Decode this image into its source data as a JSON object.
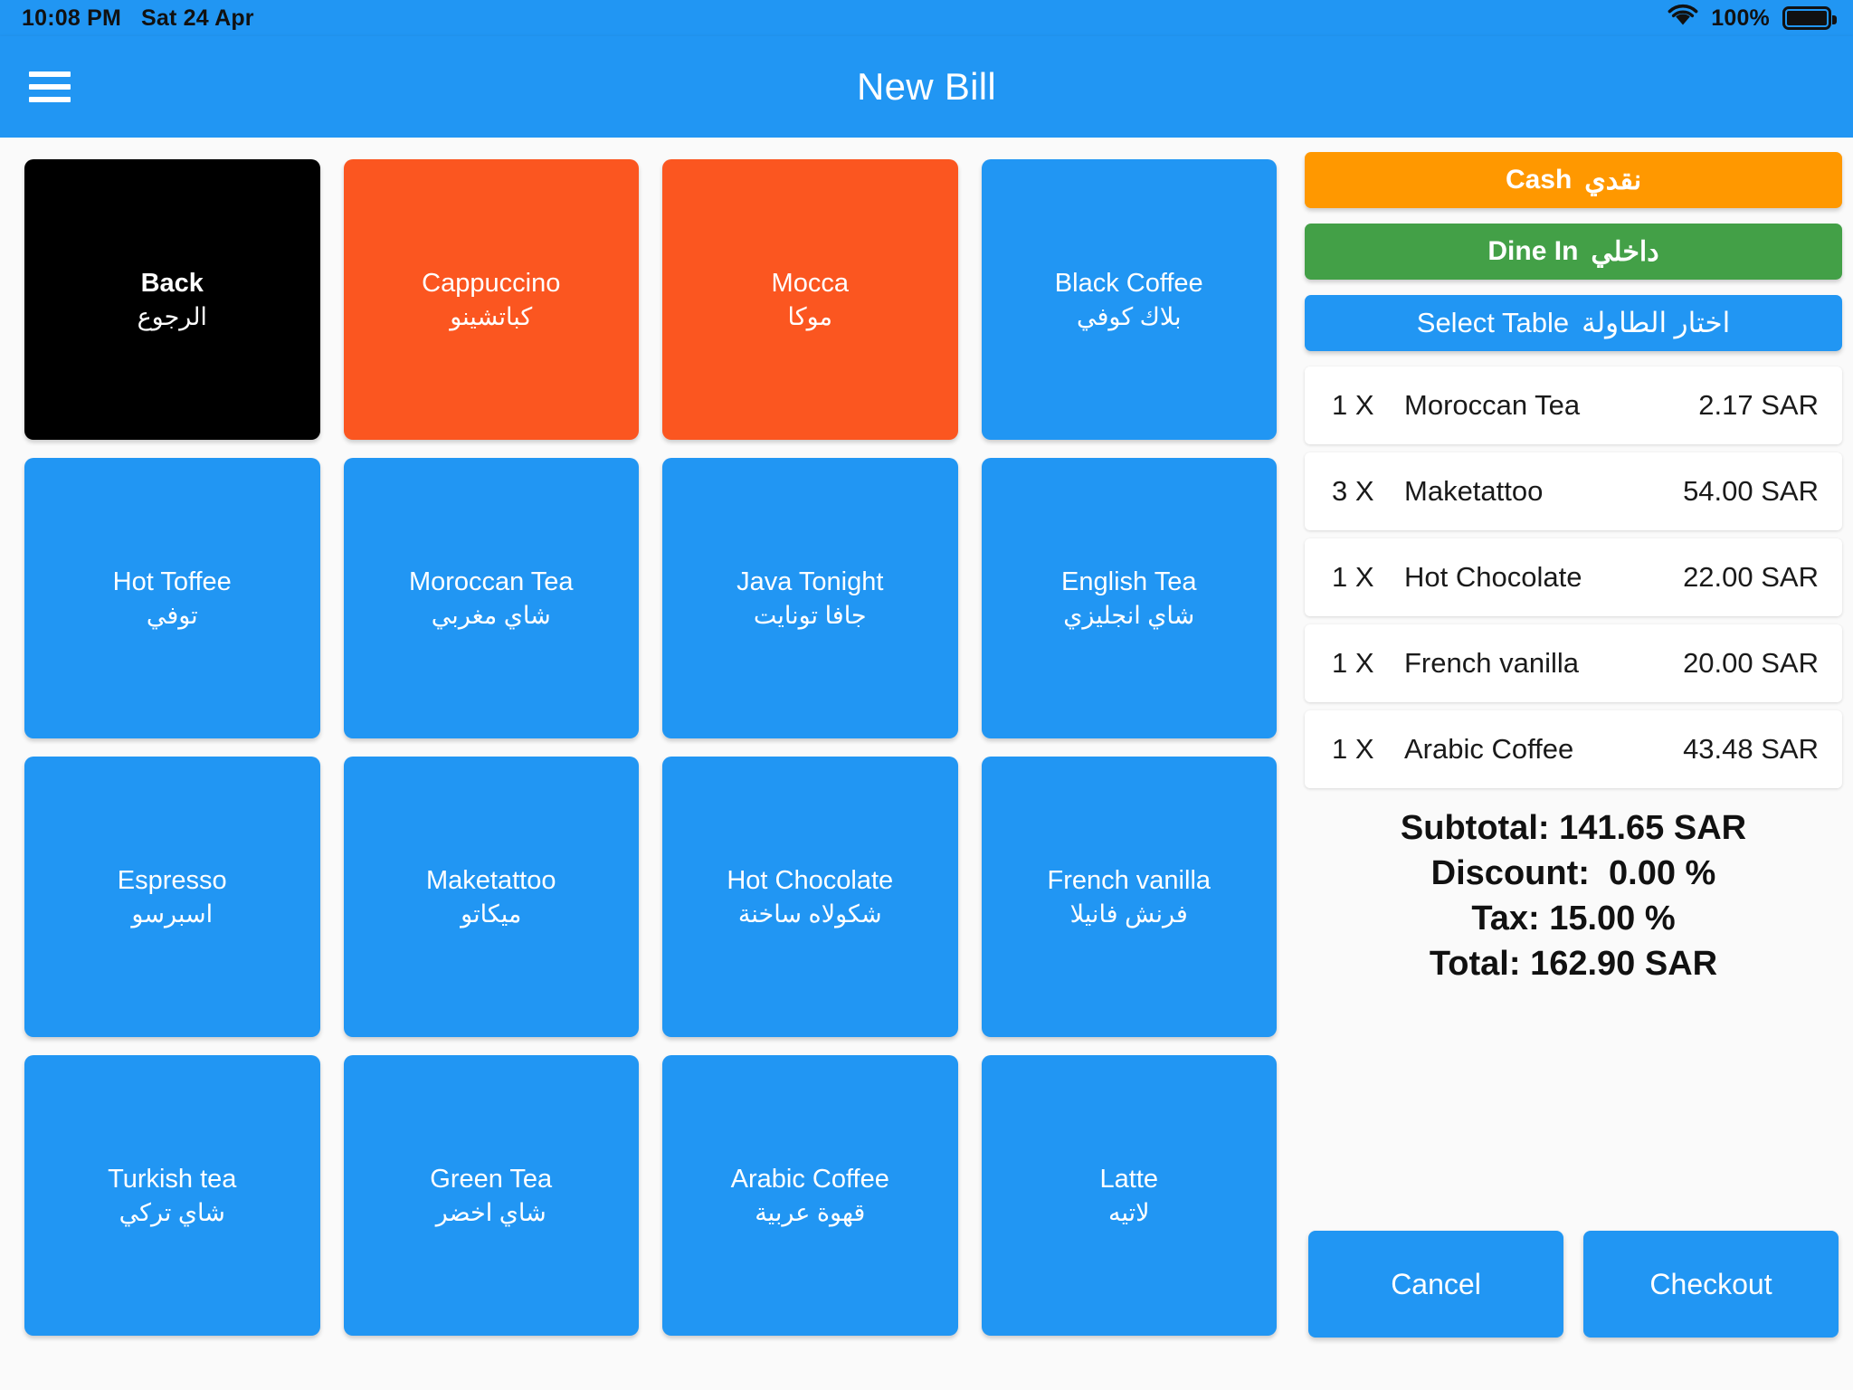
{
  "status_bar": {
    "time": "10:08 PM",
    "date": "Sat 24 Apr",
    "battery_percent": "100%",
    "wifi_icon": "wifi-icon",
    "battery_icon": "battery-full-icon"
  },
  "header": {
    "title": "New Bill",
    "menu_icon": "hamburger-menu-icon"
  },
  "colors": {
    "primary_blue": "#2196F3",
    "tile_orange": "#FB5620",
    "tile_black": "#000000",
    "cash_orange": "#FF9800",
    "dine_green": "#43A047",
    "page_background": "#FAFAFA",
    "card_white": "#FFFFFF"
  },
  "tiles": [
    {
      "en": "Back",
      "ar": "الرجوع",
      "color": "black"
    },
    {
      "en": "Cappuccino",
      "ar": "كباتشينو",
      "color": "orange"
    },
    {
      "en": "Mocca",
      "ar": "موكا",
      "color": "orange"
    },
    {
      "en": "Black Coffee",
      "ar": "بلاك كوفي",
      "color": "blue"
    },
    {
      "en": "Hot Toffee",
      "ar": "توفي",
      "color": "blue"
    },
    {
      "en": "Moroccan Tea",
      "ar": "شاي مغربي",
      "color": "blue"
    },
    {
      "en": "Java Tonight",
      "ar": "جافا تونايت",
      "color": "blue"
    },
    {
      "en": "English Tea",
      "ar": "شاي انجليزي",
      "color": "blue"
    },
    {
      "en": "Espresso",
      "ar": "اسبرسو",
      "color": "blue"
    },
    {
      "en": "Maketattoo",
      "ar": "ميكاتو",
      "color": "blue"
    },
    {
      "en": "Hot Chocolate",
      "ar": "شكولاه ساخنة",
      "color": "blue"
    },
    {
      "en": "French vanilla",
      "ar": "فرنش فانيلا",
      "color": "blue"
    },
    {
      "en": "Turkish tea",
      "ar": "شاي تركي",
      "color": "blue"
    },
    {
      "en": "Green Tea",
      "ar": "شاي اخضر",
      "color": "blue"
    },
    {
      "en": "Arabic Coffee",
      "ar": "قهوة عربية",
      "color": "blue"
    },
    {
      "en": "Latte",
      "ar": "لاتيه",
      "color": "blue"
    }
  ],
  "actions": [
    {
      "en": "Cash",
      "ar": "نقدي",
      "style": "cash"
    },
    {
      "en": "Dine In",
      "ar": "داخلي",
      "style": "dine"
    },
    {
      "en": "Select Table",
      "ar": "اختار الطاولة",
      "style": "table"
    }
  ],
  "bill_items": [
    {
      "qty": "1 X",
      "name": "Moroccan Tea",
      "amount": "2.17 SAR"
    },
    {
      "qty": "3 X",
      "name": "Maketattoo",
      "amount": "54.00 SAR"
    },
    {
      "qty": "1 X",
      "name": "Hot Chocolate",
      "amount": "22.00 SAR"
    },
    {
      "qty": "1 X",
      "name": "French vanilla",
      "amount": "20.00 SAR"
    },
    {
      "qty": "1 X",
      "name": "Arabic Coffee",
      "amount": "43.48 SAR"
    }
  ],
  "totals": {
    "subtotal": "Subtotal: 141.65 SAR",
    "discount": "Discount:  0.00 %",
    "tax": "Tax: 15.00 %",
    "total": "Total: 162.90 SAR"
  },
  "footer": {
    "cancel_label": "Cancel",
    "checkout_label": "Checkout"
  }
}
